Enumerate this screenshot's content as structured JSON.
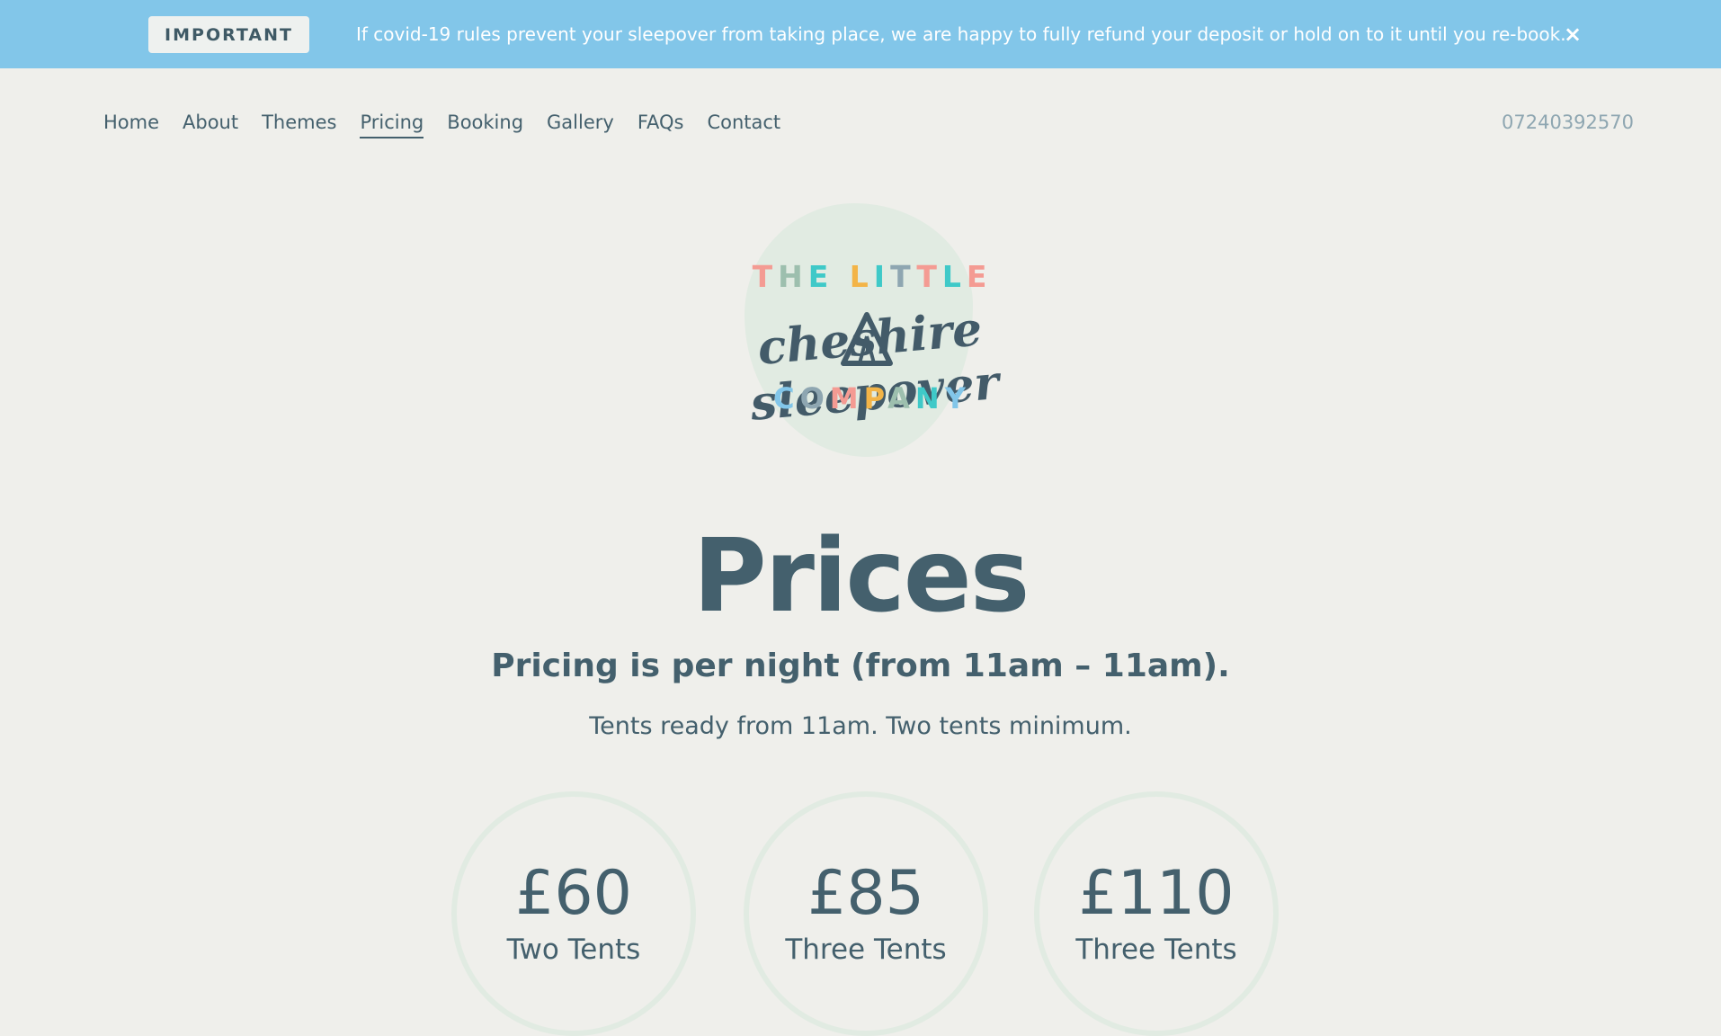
{
  "banner": {
    "badge": "IMPORTANT",
    "message": "If covid-19 rules prevent your sleepover from taking place, we are happy to fully refund your deposit or hold on to it until you re-book.",
    "close": "×"
  },
  "nav": {
    "items": [
      {
        "label": "Home"
      },
      {
        "label": "About"
      },
      {
        "label": "Themes"
      },
      {
        "label": "Pricing"
      },
      {
        "label": "Booking"
      },
      {
        "label": "Gallery"
      },
      {
        "label": "FAQs"
      },
      {
        "label": "Contact"
      }
    ],
    "active": "Pricing",
    "phone": "07240392570"
  },
  "logo": {
    "top_text": "THE LITTLE",
    "main_text": "cheshire sleepover",
    "bottom_text": "COMPANY",
    "top_colors": [
      "#f49b93",
      "#9dbfae",
      "#3fc9c8",
      "#f3b447",
      "#3fc9c8",
      "#8ea6b1",
      "#f49b93",
      "#3fc9c8"
    ],
    "bottom_colors": [
      "#82c6e9",
      "#8ea6b1",
      "#f49b93",
      "#f3b447",
      "#9dbfae",
      "#3fc9c8"
    ]
  },
  "main": {
    "title": "Prices",
    "subtitle": "Pricing is per night (from 11am – 11am).",
    "note": "Tents ready from 11am. Two tents minimum."
  },
  "pricing": [
    {
      "amount": "£60",
      "label": "Two Tents"
    },
    {
      "amount": "£85",
      "label": "Three Tents"
    },
    {
      "amount": "£110",
      "label": "Three Tents"
    }
  ],
  "colors": {
    "banner_bg": "#82c6e9",
    "page_bg": "#efefeb",
    "text": "#44606d",
    "phone": "#8ea6b1",
    "accent_circle": "#e1ebe2"
  }
}
